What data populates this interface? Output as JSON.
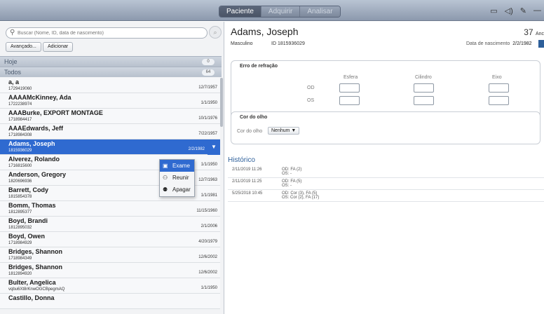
{
  "tabs": [
    {
      "label": "Paciente",
      "active": true
    },
    {
      "label": "Adquirir",
      "active": false
    },
    {
      "label": "Analisar",
      "active": false
    }
  ],
  "search": {
    "placeholder": "Buscar (Nome, ID, data de nascimento)"
  },
  "buttons": {
    "advanced": "Avançado...",
    "add": "Adicionar"
  },
  "sections": {
    "today": {
      "label": "Hoje",
      "count": "0"
    },
    "all": {
      "label": "Todos",
      "count": "64"
    }
  },
  "patients": [
    {
      "name": "a, a",
      "id": "1729419060",
      "dob": "12/7/1957"
    },
    {
      "name": "AAAAMcKinney, Ada",
      "id": "1722238974",
      "dob": "1/1/1950"
    },
    {
      "name": "AAABurke, EXPORT MONTAGE",
      "id": "1718984417",
      "dob": "10/1/1976"
    },
    {
      "name": "AAAEdwards, Jeff",
      "id": "1718984308",
      "dob": "7/22/1957"
    },
    {
      "name": "Adams, Joseph",
      "id": "1815936029",
      "dob": "2/2/1982",
      "selected": true
    },
    {
      "name": "Alverez, Rolando",
      "id": "1716815600",
      "dob": "1/1/1950"
    },
    {
      "name": "Anderson, Gregory",
      "id": "1820696936",
      "dob": "12/7/1963"
    },
    {
      "name": "Barrett, Cody",
      "id": "1815854378",
      "dob": "1/1/1981"
    },
    {
      "name": "Bomm, Thomas",
      "id": "1812895377",
      "dob": "11/15/1960"
    },
    {
      "name": "Boyd, Brandi",
      "id": "1812895032",
      "dob": "2/1/2006"
    },
    {
      "name": "Boyd, Owen",
      "id": "1718984929",
      "dob": "4/20/1979"
    },
    {
      "name": "Bridges, Shannon",
      "id": "1718984349",
      "dob": "12/6/2002"
    },
    {
      "name": "Bridges, Shannon",
      "id": "1812894920",
      "dob": "12/6/2002"
    },
    {
      "name": "Bulter, Angelica",
      "id": "vqbu6Xt8rKnwOGCBpegmAQ",
      "dob": "1/1/1950"
    },
    {
      "name": "Castillo, Donna",
      "id": "",
      "dob": ""
    }
  ],
  "context_menu": [
    {
      "label": "Exame",
      "icon": "exam-icon",
      "active": true
    },
    {
      "label": "Reunir",
      "icon": "merge-icon",
      "active": false
    },
    {
      "label": "Apagar",
      "icon": "delete-user-icon",
      "active": false
    }
  ],
  "detail": {
    "name": "Adams, Joseph",
    "age": "37",
    "age_unit": "Anc",
    "sex": "Masculino",
    "id_label": "ID",
    "id": "1815936029",
    "dob_label": "Data de nascimento",
    "dob": "2/2/1982"
  },
  "refraction": {
    "title": "Erro de refração",
    "columns": [
      "Esfera",
      "Cilindro",
      "Eixo"
    ],
    "rows": [
      "OD",
      "OS"
    ]
  },
  "eye_color": {
    "title": "Cor do olho",
    "label": "Cor do olho",
    "value": "Nenhum"
  },
  "history": {
    "title": "Histórico",
    "entries": [
      {
        "date": "2/11/2019 11:26",
        "od": "OD: FA (2)",
        "os": "OS: -"
      },
      {
        "date": "2/11/2019 11:25",
        "od": "OD: FA (5)",
        "os": "OS: -"
      },
      {
        "date": "5/25/2018 10:45",
        "od": "OD: Cor (3), FA (5)",
        "os": "OS: Cor (2), FA (17)"
      }
    ]
  },
  "colors": {
    "accent": "#2f6ad0",
    "link": "#2d5f9a"
  }
}
